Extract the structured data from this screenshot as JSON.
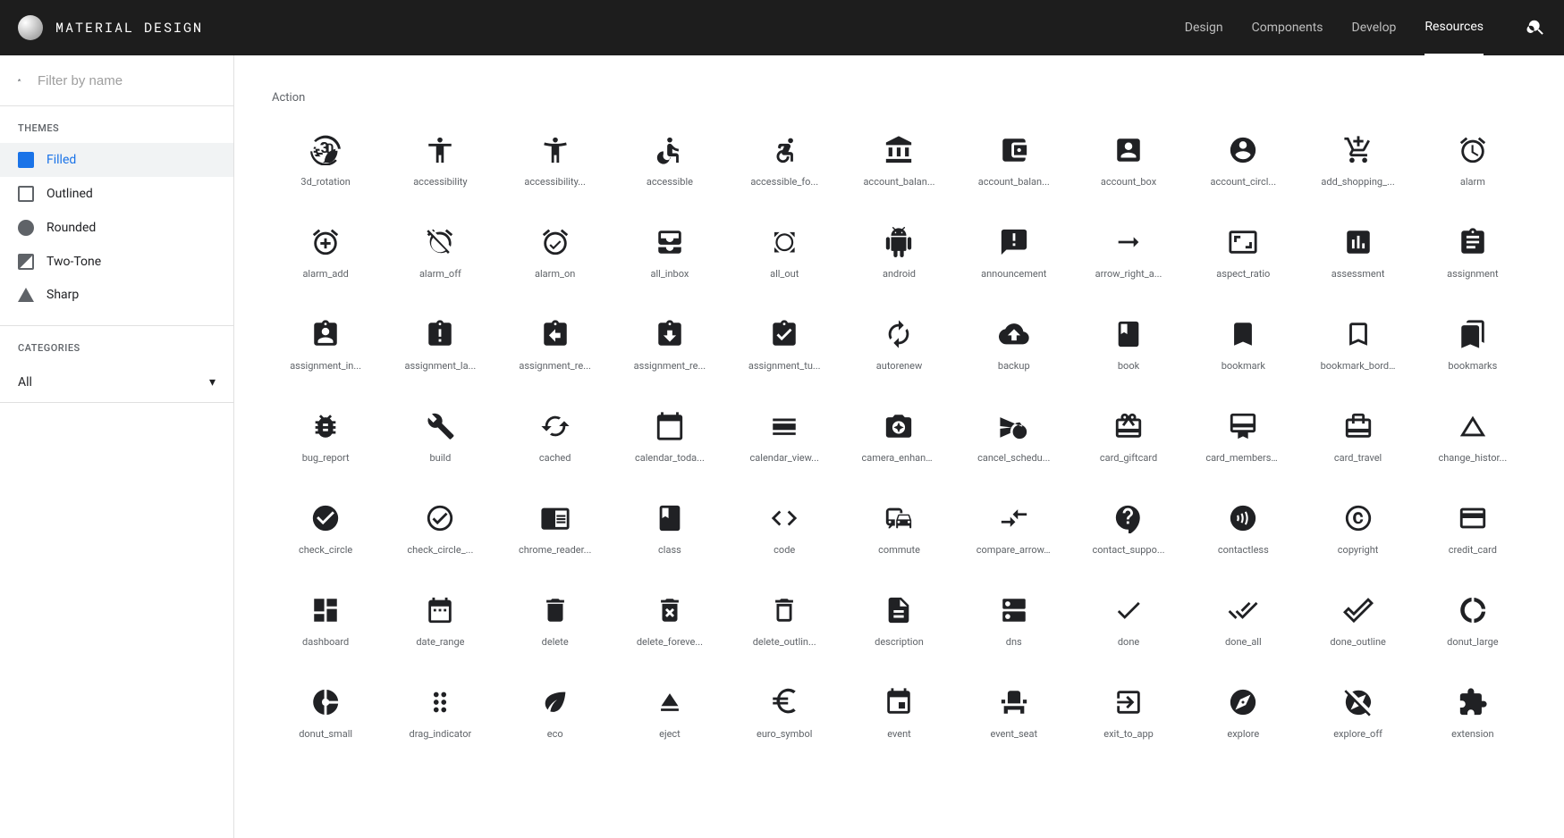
{
  "header": {
    "title": "MATERIAL DESIGN",
    "nav": [
      "Design",
      "Components",
      "Develop",
      "Resources"
    ],
    "active_nav": "Resources"
  },
  "sidebar": {
    "filter_placeholder": "Filter by name",
    "themes_label": "THEMES",
    "themes": [
      "Filled",
      "Outlined",
      "Rounded",
      "Two-Tone",
      "Sharp"
    ],
    "active_theme": "Filled",
    "categories_label": "CATEGORIES",
    "category_selected": "All"
  },
  "main": {
    "category": "Action",
    "icons": [
      {
        "name": "3d_rotation",
        "label": "3d_rotation",
        "svg": "txt3d"
      },
      {
        "name": "accessibility",
        "label": "accessibility",
        "svg": "accessibility"
      },
      {
        "name": "accessibility_new",
        "label": "accessibility...",
        "svg": "accessibility_new"
      },
      {
        "name": "accessible",
        "label": "accessible",
        "svg": "accessible"
      },
      {
        "name": "accessible_forward",
        "label": "accessible_fo...",
        "svg": "accessible_forward"
      },
      {
        "name": "account_balance",
        "label": "account_balan...",
        "svg": "account_balance"
      },
      {
        "name": "account_balance_wallet",
        "label": "account_balan...",
        "svg": "account_balance_wallet"
      },
      {
        "name": "account_box",
        "label": "account_box",
        "svg": "account_box"
      },
      {
        "name": "account_circle",
        "label": "account_circl...",
        "svg": "account_circle"
      },
      {
        "name": "add_shopping_cart",
        "label": "add_shopping_...",
        "svg": "add_shopping_cart"
      },
      {
        "name": "alarm",
        "label": "alarm",
        "svg": "alarm"
      },
      {
        "name": "alarm_add",
        "label": "alarm_add",
        "svg": "alarm_add"
      },
      {
        "name": "alarm_off",
        "label": "alarm_off",
        "svg": "alarm_off"
      },
      {
        "name": "alarm_on",
        "label": "alarm_on",
        "svg": "alarm_on"
      },
      {
        "name": "all_inbox",
        "label": "all_inbox",
        "svg": "all_inbox"
      },
      {
        "name": "all_out",
        "label": "all_out",
        "svg": "all_out"
      },
      {
        "name": "android",
        "label": "android",
        "svg": "android"
      },
      {
        "name": "announcement",
        "label": "announcement",
        "svg": "announcement"
      },
      {
        "name": "arrow_right_alt",
        "label": "arrow_right_a...",
        "svg": "arrow_right_alt"
      },
      {
        "name": "aspect_ratio",
        "label": "aspect_ratio",
        "svg": "aspect_ratio"
      },
      {
        "name": "assessment",
        "label": "assessment",
        "svg": "assessment"
      },
      {
        "name": "assignment",
        "label": "assignment",
        "svg": "assignment"
      },
      {
        "name": "assignment_ind",
        "label": "assignment_in...",
        "svg": "assignment_ind"
      },
      {
        "name": "assignment_late",
        "label": "assignment_la...",
        "svg": "assignment_late"
      },
      {
        "name": "assignment_return",
        "label": "assignment_re...",
        "svg": "assignment_return"
      },
      {
        "name": "assignment_returned",
        "label": "assignment_re...",
        "svg": "assignment_returned"
      },
      {
        "name": "assignment_turned_in",
        "label": "assignment_tu...",
        "svg": "assignment_turned_in"
      },
      {
        "name": "autorenew",
        "label": "autorenew",
        "svg": "autorenew"
      },
      {
        "name": "backup",
        "label": "backup",
        "svg": "backup"
      },
      {
        "name": "book",
        "label": "book",
        "svg": "book"
      },
      {
        "name": "bookmark",
        "label": "bookmark",
        "svg": "bookmark"
      },
      {
        "name": "bookmark_border",
        "label": "bookmark_bord...",
        "svg": "bookmark_border"
      },
      {
        "name": "bookmarks",
        "label": "bookmarks",
        "svg": "bookmarks"
      },
      {
        "name": "bug_report",
        "label": "bug_report",
        "svg": "bug_report"
      },
      {
        "name": "build",
        "label": "build",
        "svg": "build"
      },
      {
        "name": "cached",
        "label": "cached",
        "svg": "cached"
      },
      {
        "name": "calendar_today",
        "label": "calendar_toda...",
        "svg": "calendar_today"
      },
      {
        "name": "calendar_view_day",
        "label": "calendar_view...",
        "svg": "calendar_view_day"
      },
      {
        "name": "camera_enhance",
        "label": "camera_enhanc...",
        "svg": "camera_enhance"
      },
      {
        "name": "cancel_schedule_send",
        "label": "cancel_schedu...",
        "svg": "cancel_schedule_send"
      },
      {
        "name": "card_giftcard",
        "label": "card_giftcard",
        "svg": "card_giftcard"
      },
      {
        "name": "card_membership",
        "label": "card_membersh...",
        "svg": "card_membership"
      },
      {
        "name": "card_travel",
        "label": "card_travel",
        "svg": "card_travel"
      },
      {
        "name": "change_history",
        "label": "change_histor...",
        "svg": "change_history"
      },
      {
        "name": "check_circle",
        "label": "check_circle",
        "svg": "check_circle"
      },
      {
        "name": "check_circle_outline",
        "label": "check_circle_...",
        "svg": "check_circle_outline"
      },
      {
        "name": "chrome_reader_mode",
        "label": "chrome_reader...",
        "svg": "chrome_reader_mode"
      },
      {
        "name": "class",
        "label": "class",
        "svg": "book"
      },
      {
        "name": "code",
        "label": "code",
        "svg": "code"
      },
      {
        "name": "commute",
        "label": "commute",
        "svg": "commute"
      },
      {
        "name": "compare_arrows",
        "label": "compare_arrow...",
        "svg": "compare_arrows"
      },
      {
        "name": "contact_support",
        "label": "contact_suppo...",
        "svg": "contact_support"
      },
      {
        "name": "contactless",
        "label": "contactless",
        "svg": "contactless"
      },
      {
        "name": "copyright",
        "label": "copyright",
        "svg": "copyright"
      },
      {
        "name": "credit_card",
        "label": "credit_card",
        "svg": "credit_card"
      },
      {
        "name": "dashboard",
        "label": "dashboard",
        "svg": "dashboard"
      },
      {
        "name": "date_range",
        "label": "date_range",
        "svg": "date_range"
      },
      {
        "name": "delete",
        "label": "delete",
        "svg": "delete"
      },
      {
        "name": "delete_forever",
        "label": "delete_foreve...",
        "svg": "delete_forever"
      },
      {
        "name": "delete_outline",
        "label": "delete_outlin...",
        "svg": "delete_outline"
      },
      {
        "name": "description",
        "label": "description",
        "svg": "description"
      },
      {
        "name": "dns",
        "label": "dns",
        "svg": "dns"
      },
      {
        "name": "done",
        "label": "done",
        "svg": "done"
      },
      {
        "name": "done_all",
        "label": "done_all",
        "svg": "done_all"
      },
      {
        "name": "done_outline",
        "label": "done_outline",
        "svg": "done_outline"
      },
      {
        "name": "donut_large",
        "label": "donut_large",
        "svg": "donut_large"
      },
      {
        "name": "donut_small",
        "label": "donut_small",
        "svg": "donut_small"
      },
      {
        "name": "drag_indicator",
        "label": "drag_indicator",
        "svg": "drag_indicator"
      },
      {
        "name": "eco",
        "label": "eco",
        "svg": "eco"
      },
      {
        "name": "eject",
        "label": "eject",
        "svg": "eject"
      },
      {
        "name": "euro_symbol",
        "label": "euro_symbol",
        "svg": "euro_symbol"
      },
      {
        "name": "event",
        "label": "event",
        "svg": "event"
      },
      {
        "name": "event_seat",
        "label": "event_seat",
        "svg": "event_seat"
      },
      {
        "name": "exit_to_app",
        "label": "exit_to_app",
        "svg": "exit_to_app"
      },
      {
        "name": "explore",
        "label": "explore",
        "svg": "explore"
      },
      {
        "name": "explore_off",
        "label": "explore_off",
        "svg": "explore_off"
      },
      {
        "name": "extension",
        "label": "extension",
        "svg": "extension"
      }
    ]
  }
}
